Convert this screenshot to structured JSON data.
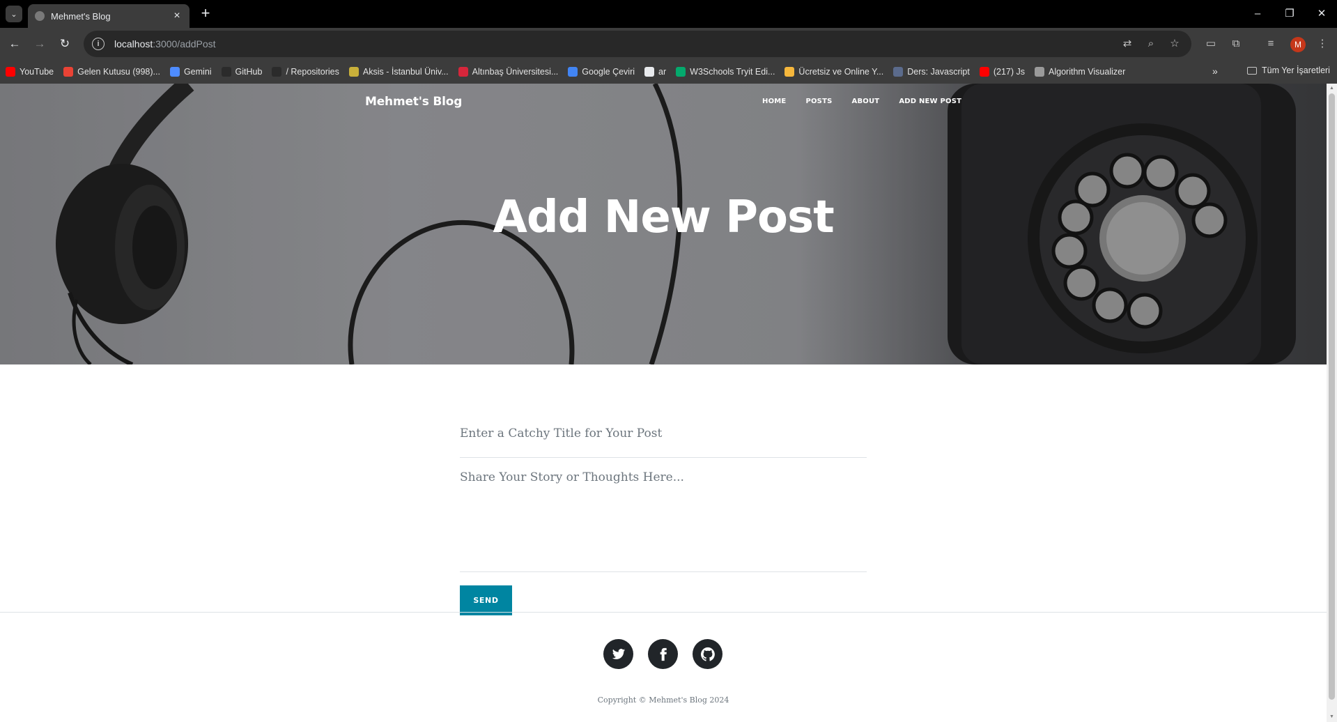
{
  "browser": {
    "tab_title": "Mehmet's Blog",
    "url_host": "localhost",
    "url_rest": ":3000/addPost",
    "profile_initial": "M",
    "bookmarks": [
      {
        "label": "YouTube",
        "color": "#ff0000"
      },
      {
        "label": "Gelen Kutusu (998)...",
        "color": "#ea4335"
      },
      {
        "label": "Gemini",
        "color": "#4e8cff"
      },
      {
        "label": "GitHub",
        "color": "#2b2b2b"
      },
      {
        "label": "/ Repositories",
        "color": "#2b2b2b"
      },
      {
        "label": "Aksis - İstanbul Üniv...",
        "color": "#c9b03a"
      },
      {
        "label": "Altınbaş Üniversitesi...",
        "color": "#d6263b"
      },
      {
        "label": "Google Çeviri",
        "color": "#4285f4"
      },
      {
        "label": "ar",
        "color": "#e8eaed"
      },
      {
        "label": "W3Schools Tryit Edi...",
        "color": "#04aa6d"
      },
      {
        "label": "Ücretsiz ve Online Y...",
        "color": "#f6b73c"
      },
      {
        "label": "Ders: Javascript",
        "color": "#5b6b8c"
      },
      {
        "label": "(217) Js",
        "color": "#ff0000"
      },
      {
        "label": "Algorithm Visualizer",
        "color": "#9a9a9a"
      }
    ],
    "bookmarks_folder": "Tüm Yer İşaretleri"
  },
  "site": {
    "brand": "Mehmet's Blog",
    "nav": [
      "HOME",
      "POSTS",
      "ABOUT",
      "ADD NEW POST"
    ],
    "heading": "Add New Post",
    "form": {
      "title_placeholder": "Enter a Catchy Title for Your Post",
      "body_placeholder": "Share Your Story or Thoughts Here...",
      "send_label": "SEND"
    },
    "footer": {
      "social_icons": [
        "twitter-icon",
        "facebook-icon",
        "github-icon"
      ],
      "copyright": "Copyright © Mehmet's Blog 2024"
    }
  },
  "colors": {
    "accent": "#0085a1",
    "social_bg": "#212529"
  }
}
